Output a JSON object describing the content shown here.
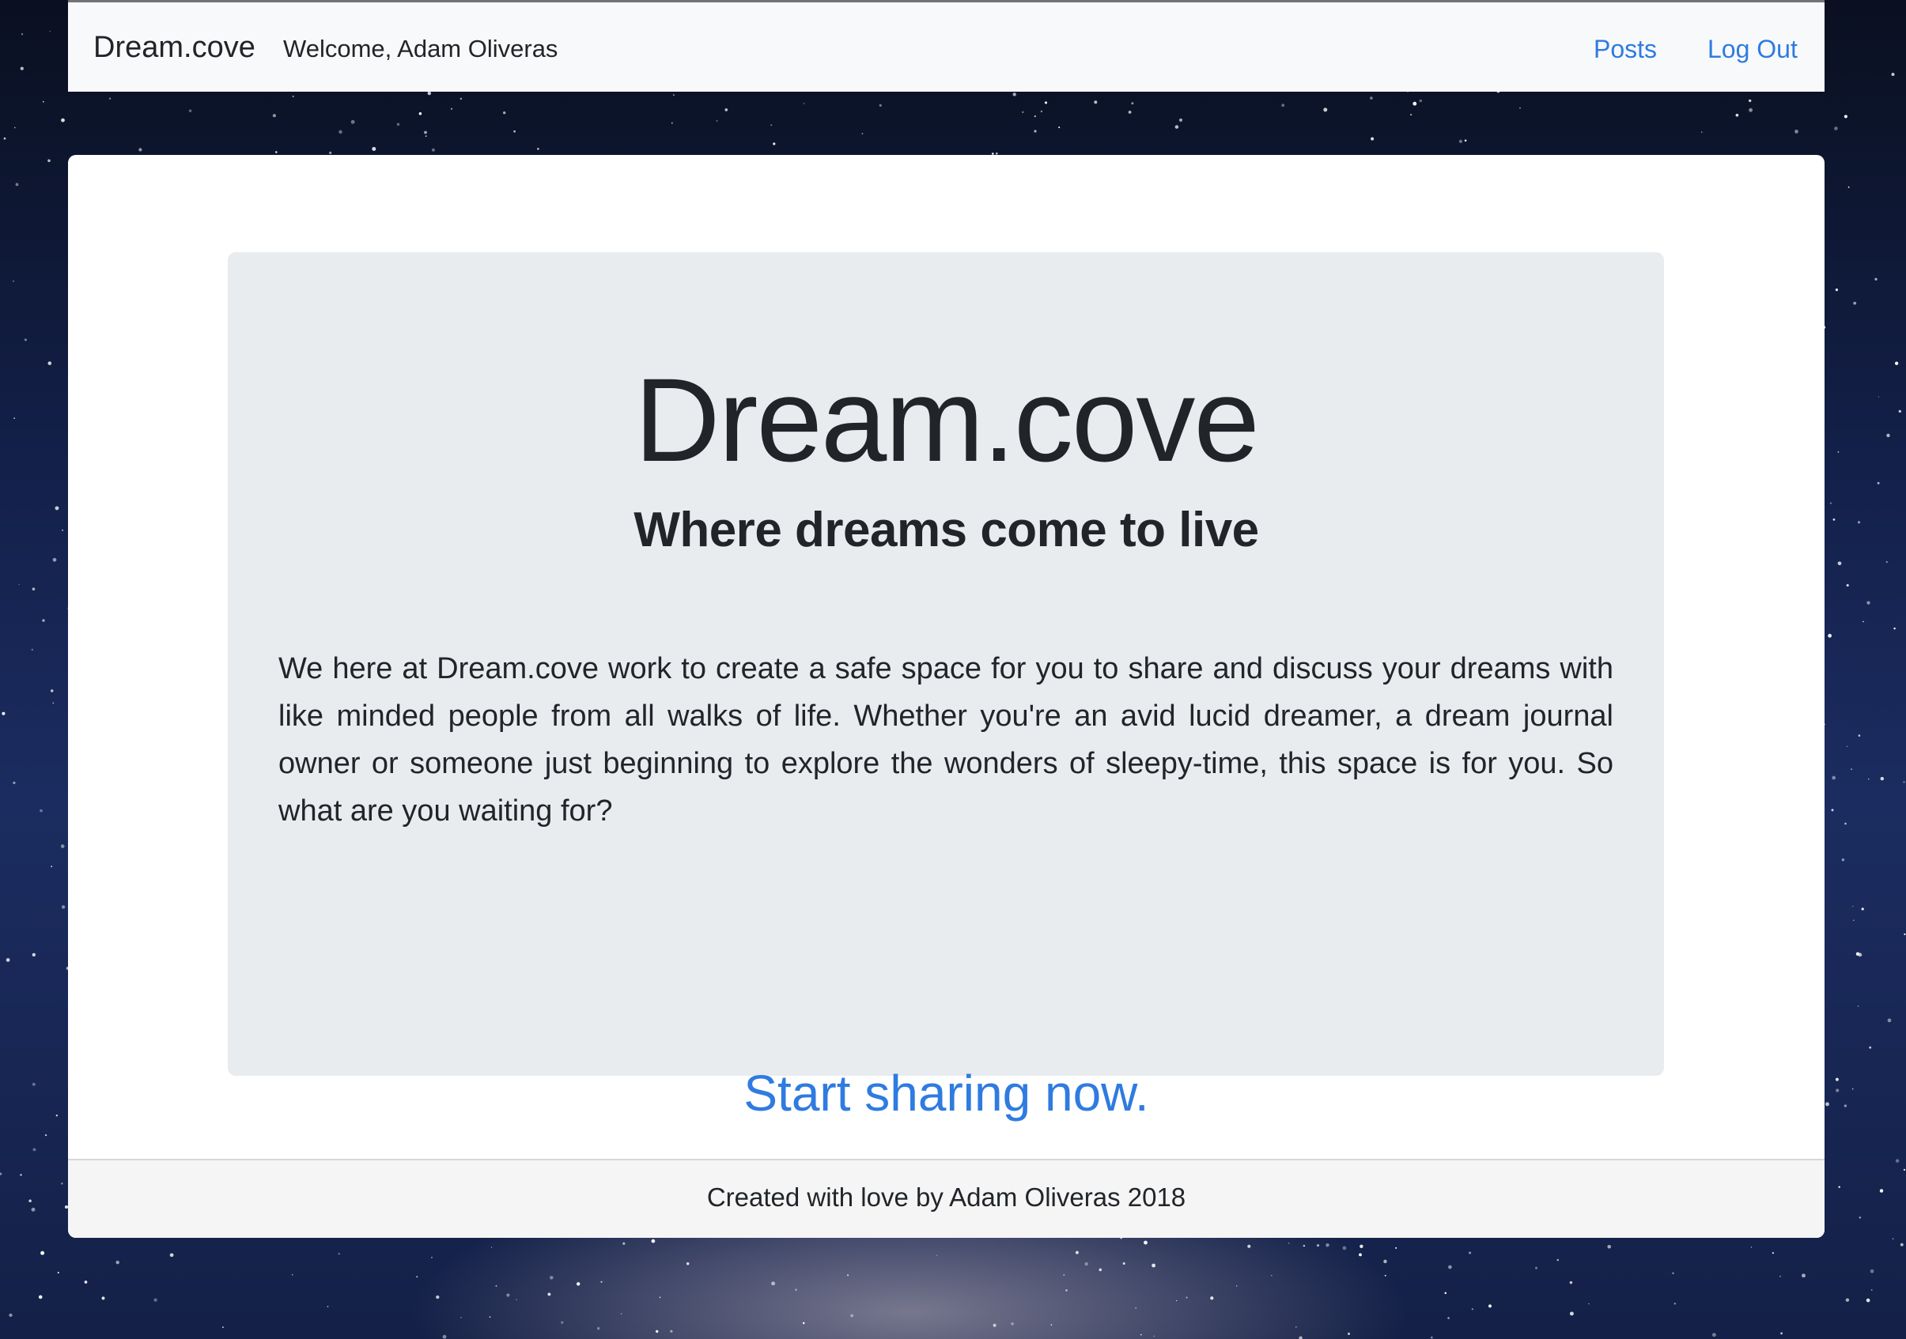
{
  "navbar": {
    "brand": "Dream.cove",
    "welcome": "Welcome, Adam Oliveras",
    "links": {
      "posts": "Posts",
      "logout": "Log Out"
    }
  },
  "hero": {
    "title": "Dream.cove",
    "subtitle": "Where dreams come to live",
    "body": "We here at Dream.cove work to create a safe space for you to share and discuss your dreams with like minded people from all walks of life. Whether you're an avid lucid dreamer, a dream journal owner or someone just beginning to explore the wonders of sleepy-time, this space is for you. So what are you waiting for?",
    "cta": "Start sharing now."
  },
  "footer": {
    "text": "Created with love by Adam Oliveras 2018"
  },
  "colors": {
    "navbar_bg": "#f8f9fa",
    "link": "#2f7be0",
    "jumbotron_bg": "#e9ecef",
    "footer_bg": "#f5f5f5",
    "text": "#212529"
  }
}
